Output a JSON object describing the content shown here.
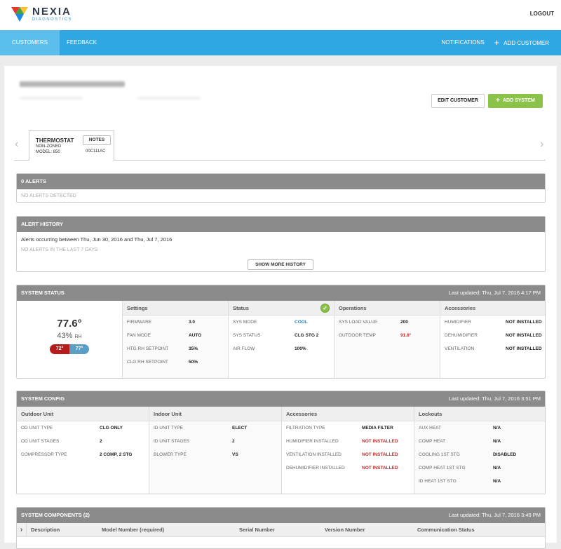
{
  "header": {
    "logo_main": "NEXIA",
    "logo_sub": "DIAGNOSTICS",
    "logout": "LOGOUT"
  },
  "nav": {
    "items": [
      {
        "label": "CUSTOMERS",
        "active": true
      },
      {
        "label": "FEEDBACK",
        "active": false
      }
    ],
    "notifications": "NOTIFICATIONS",
    "add_customer": "ADD CUSTOMER"
  },
  "customer": {
    "edit_label": "EDIT CUSTOMER",
    "add_system_label": "ADD SYSTEM"
  },
  "device_tab": {
    "title": "THERMOSTAT",
    "zoning": "NON-ZONED",
    "model": "MODEL: 850",
    "notes_label": "NOTES",
    "mac": "00C111AC"
  },
  "alerts": {
    "title": "0 ALERTS",
    "message": "NO ALERTS DETECTED"
  },
  "alert_history": {
    "title": "ALERT HISTORY",
    "range_text": "Alerts occurring between Thu, Jun 30, 2016 and Thu, Jul 7, 2016",
    "empty_text": "NO ALERTS IN THE LAST 7 DAYS",
    "button": "SHOW MORE HISTORY"
  },
  "system_status": {
    "title": "SYSTEM STATUS",
    "updated": "Last updated: Thu, Jul 7, 2016 4:17 PM",
    "temperature": "77.6°",
    "humidity_value": "43%",
    "humidity_unit": "RH",
    "heat_setpoint": "72°",
    "cool_setpoint": "77°",
    "columns": [
      {
        "header": "Settings",
        "rows": [
          {
            "k": "FIRMWARE",
            "v": "3.0"
          },
          {
            "k": "FAN MODE",
            "v": "AUTO"
          },
          {
            "k": "HTG RH SETPOINT",
            "v": "35%"
          },
          {
            "k": "CLG RH SETPOINT",
            "v": "50%"
          }
        ]
      },
      {
        "header": "Status",
        "rows": [
          {
            "k": "SYS MODE",
            "v": "COOL"
          },
          {
            "k": "SYS STATUS",
            "v": "CLG STG 2"
          },
          {
            "k": "AIR FLOW",
            "v": "100%"
          }
        ]
      },
      {
        "header": "Operations",
        "rows": [
          {
            "k": "SYS LOAD VALUE",
            "v": "200"
          },
          {
            "k": "OUTDOOR TEMP",
            "v": "91.8°"
          }
        ]
      },
      {
        "header": "Accessories",
        "rows": [
          {
            "k": "HUMIDIFIER",
            "v": "NOT INSTALLED"
          },
          {
            "k": "DEHUMIDIFIER",
            "v": "NOT INSTALLED"
          },
          {
            "k": "VENTILATION",
            "v": "NOT INSTALLED"
          }
        ]
      }
    ]
  },
  "system_config": {
    "title": "SYSTEM CONFIG",
    "updated": "Last updated: Thu, Jul 7, 2016 3:51 PM",
    "columns": [
      {
        "header": "Outdoor Unit",
        "rows": [
          {
            "k": "OD UNIT TYPE",
            "v": "CLG ONLY"
          },
          {
            "k": "OD UNIT STAGES",
            "v": "2"
          },
          {
            "k": "COMPRESSOR TYPE",
            "v": "2 COMP, 2 STG"
          }
        ]
      },
      {
        "header": "Indoor Unit",
        "rows": [
          {
            "k": "ID UNIT TYPE",
            "v": "ELECT"
          },
          {
            "k": "ID UNIT STAGES",
            "v": "2"
          },
          {
            "k": "BLOWER TYPE",
            "v": "VS"
          }
        ]
      },
      {
        "header": "Accessories",
        "rows": [
          {
            "k": "FILTRATION TYPE",
            "v": "MEDIA FILTER"
          },
          {
            "k": "HUMIDIFIER INSTALLED",
            "v": "NOT INSTALLED"
          },
          {
            "k": "VENTILATION INSTALLED",
            "v": "NOT INSTALLED"
          },
          {
            "k": "DEHUMIDIFIER INSTALLED",
            "v": "NOT INSTALLED"
          }
        ]
      },
      {
        "header": "Lockouts",
        "rows": [
          {
            "k": "AUX HEAT",
            "v": "N/A"
          },
          {
            "k": "COMP HEAT",
            "v": "N/A"
          },
          {
            "k": "COOLING 1ST STG",
            "v": "DISABLED"
          },
          {
            "k": "COMP HEAT 1ST STG",
            "v": "N/A"
          },
          {
            "k": "ID HEAT 1ST STG",
            "v": "N/A"
          }
        ]
      }
    ]
  },
  "system_components": {
    "title": "SYSTEM COMPONENTS (2)",
    "updated": "Last updated: Thu, Jul 7, 2016 3:49 PM",
    "headers": [
      "Description",
      "Model Number (required)",
      "Serial Number",
      "Version Number",
      "Communication Status"
    ]
  },
  "colors": {
    "nav": "#2fa7e3",
    "nav_active": "#5cbeed",
    "panel_header": "#8b8b8b",
    "add_green": "#8bc34a",
    "alert_red": "#c62828",
    "cool_blue": "#2b8ac4"
  }
}
